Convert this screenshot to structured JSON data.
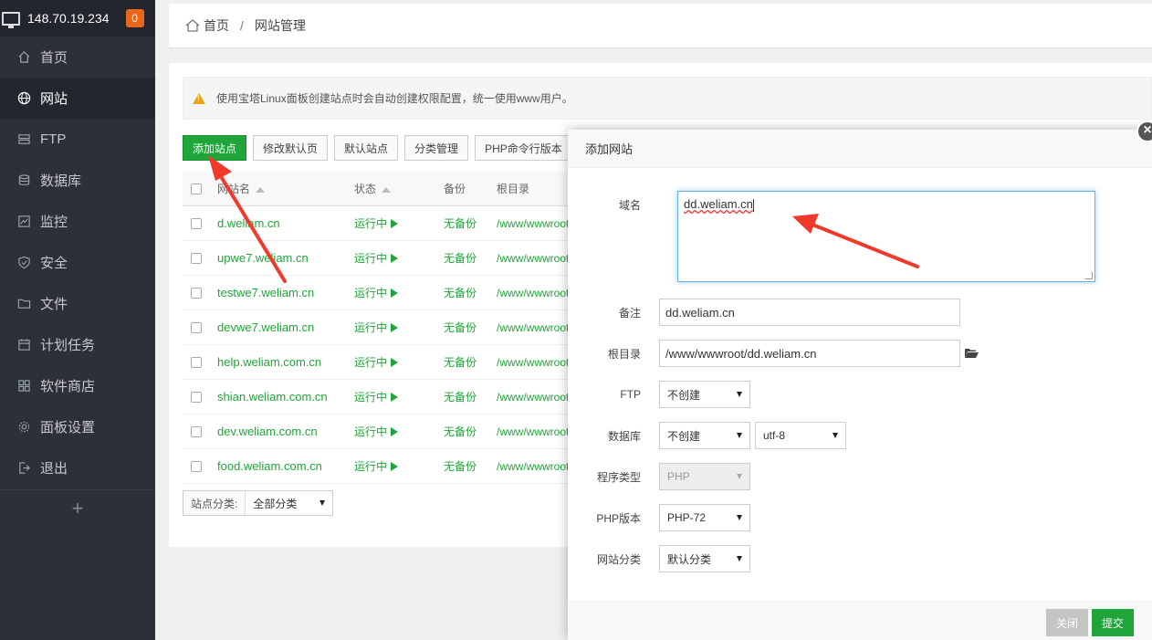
{
  "sidebar": {
    "ip": "148.70.19.234",
    "badge": "0",
    "items": [
      {
        "label": "首页",
        "icon": "home-icon"
      },
      {
        "label": "网站",
        "icon": "globe-icon"
      },
      {
        "label": "FTP",
        "icon": "ftp-icon"
      },
      {
        "label": "数据库",
        "icon": "database-icon"
      },
      {
        "label": "监控",
        "icon": "monitor-icon"
      },
      {
        "label": "安全",
        "icon": "shield-icon"
      },
      {
        "label": "文件",
        "icon": "folder-icon"
      },
      {
        "label": "计划任务",
        "icon": "calendar-icon"
      },
      {
        "label": "软件商店",
        "icon": "apps-icon"
      },
      {
        "label": "面板设置",
        "icon": "gear-icon"
      },
      {
        "label": "退出",
        "icon": "logout-icon"
      }
    ],
    "add_label": "+"
  },
  "breadcrumb": {
    "home": "首页",
    "separator": "/",
    "current": "网站管理"
  },
  "alert": {
    "text": "使用宝塔Linux面板创建站点时会自动创建权限配置，统一使用www用户。"
  },
  "toolbar": {
    "add_site": "添加站点",
    "edit_default": "修改默认页",
    "default_site": "默认站点",
    "category_mgmt": "分类管理",
    "php_cli": "PHP命令行版本"
  },
  "table": {
    "headers": {
      "name": "网站名",
      "status": "状态",
      "backup": "备份",
      "root": "根目录"
    },
    "rows": [
      {
        "name": "d.weliam.cn",
        "status": "运行中",
        "backup": "无备份",
        "root": "/www/wwwroot"
      },
      {
        "name": "upwe7.weliam.cn",
        "status": "运行中",
        "backup": "无备份",
        "root": "/www/wwwroot"
      },
      {
        "name": "testwe7.weliam.cn",
        "status": "运行中",
        "backup": "无备份",
        "root": "/www/wwwroot"
      },
      {
        "name": "devwe7.weliam.cn",
        "status": "运行中",
        "backup": "无备份",
        "root": "/www/wwwroot"
      },
      {
        "name": "help.weliam.com.cn",
        "status": "运行中",
        "backup": "无备份",
        "root": "/www/wwwroot"
      },
      {
        "name": "shian.weliam.com.cn",
        "status": "运行中",
        "backup": "无备份",
        "root": "/www/wwwroot"
      },
      {
        "name": "dev.weliam.com.cn",
        "status": "运行中",
        "backup": "无备份",
        "root": "/www/wwwroot"
      },
      {
        "name": "food.weliam.com.cn",
        "status": "运行中",
        "backup": "无备份",
        "root": "/www/wwwroot"
      }
    ]
  },
  "category_filter": {
    "label": "站点分类:",
    "value": "全部分类"
  },
  "modal": {
    "title": "添加网站",
    "close_icon": "×",
    "domain_label": "域名",
    "domain_value": "dd.weliam.cn",
    "remark_label": "备注",
    "remark_value": "dd.weliam.cn",
    "root_label": "根目录",
    "root_value": "/www/wwwroot/dd.weliam.cn",
    "ftp_label": "FTP",
    "ftp_value": "不创建",
    "db_label": "数据库",
    "db_value": "不创建",
    "db_charset": "utf-8",
    "prog_label": "程序类型",
    "prog_value": "PHP",
    "php_label": "PHP版本",
    "php_value": "PHP-72",
    "cat_label": "网站分类",
    "cat_value": "默认分类",
    "close_btn": "关闭",
    "submit_btn": "提交"
  },
  "colors": {
    "accent": "#20a53a",
    "sidebar": "#2d3038",
    "arrow": "#f03a2b"
  }
}
